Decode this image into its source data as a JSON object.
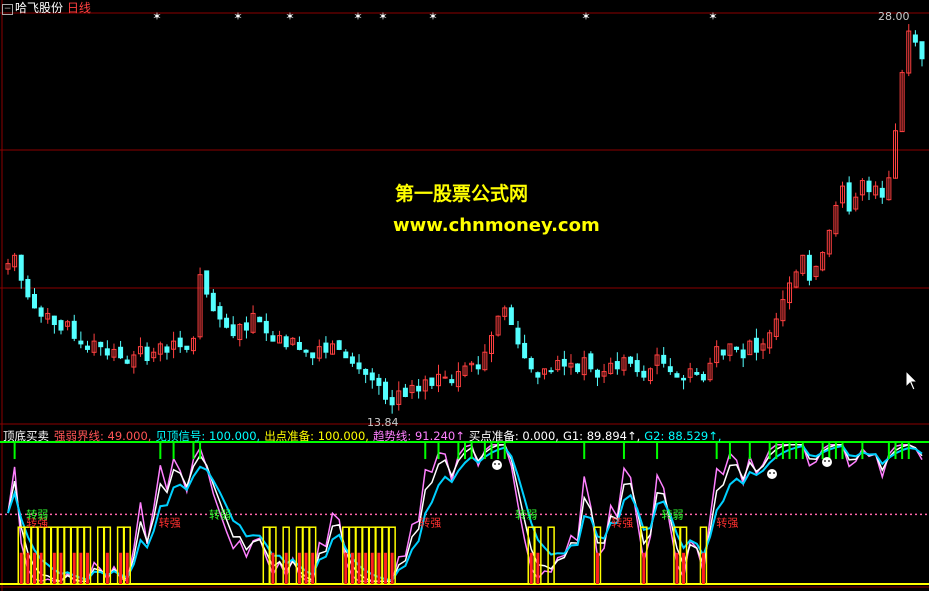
{
  "header": {
    "stock_name": "哈飞股份",
    "period": "日线",
    "price_high_label": "28.00",
    "price_low_label": "13.84"
  },
  "watermark": {
    "line1": "第一股票公式网",
    "line2": "www.chnmoney.com"
  },
  "indicator": {
    "name": "顶底买卖",
    "items": [
      {
        "label": "强弱界线: ",
        "value": "49.000,",
        "color": "#ff5555"
      },
      {
        "label": "见顶信号: ",
        "value": "100.000,",
        "color": "#00ffff"
      },
      {
        "label": "出点准备: ",
        "value": "100.000,",
        "color": "#ffff00"
      },
      {
        "label": "趋势线: ",
        "value": "91.240↑",
        "color": "#ff80ff"
      },
      {
        "label": "买点准备: ",
        "value": "0.000,",
        "color": "#ffffff"
      },
      {
        "label": "G1: ",
        "value": "89.894↑,",
        "color": "#ffffff"
      },
      {
        "label": "G2: ",
        "value": "88.529↑,",
        "color": "#00ffff"
      }
    ],
    "threshold": 49
  },
  "signals": {
    "turn_strong": "转强",
    "turn_weak": "转弱"
  },
  "colors": {
    "up": "#ff4040",
    "down": "#54ffff",
    "grid": "#8b0000",
    "threshold": "#ff66aa",
    "g1": "#ffffff",
    "g2": "#00d0ff",
    "trend": "#ff80ff",
    "yellow": "#ffff00",
    "green": "#00ff00"
  },
  "chart_data": {
    "type": "candlestick",
    "price_range": [
      13.84,
      28.0
    ],
    "closes": [
      19.2,
      19.5,
      18.6,
      18.0,
      17.6,
      17.3,
      17.4,
      17.0,
      16.8,
      17.1,
      16.5,
      16.3,
      16.1,
      16.4,
      16.2,
      15.9,
      16.1,
      15.8,
      15.6,
      15.9,
      16.2,
      15.7,
      16.0,
      16.3,
      16.0,
      16.4,
      16.2,
      16.1,
      16.5,
      18.8,
      18.1,
      17.5,
      17.2,
      16.9,
      16.6,
      17.0,
      16.8,
      17.4,
      17.1,
      16.7,
      16.4,
      16.6,
      16.2,
      16.5,
      16.1,
      16.0,
      15.8,
      16.2,
      16.0,
      16.3,
      16.1,
      15.8,
      15.6,
      15.4,
      15.2,
      15.0,
      14.8,
      14.3,
      14.1,
      14.6,
      14.4,
      14.8,
      14.6,
      15.0,
      14.8,
      15.2,
      15.1,
      14.9,
      15.3,
      15.5,
      15.6,
      15.4,
      16.0,
      16.6,
      17.3,
      17.6,
      17.0,
      16.3,
      15.8,
      15.4,
      15.1,
      15.4,
      15.3,
      15.7,
      15.5,
      15.6,
      15.3,
      15.8,
      15.4,
      15.1,
      15.3,
      15.6,
      15.4,
      15.8,
      15.6,
      15.3,
      15.1,
      15.4,
      15.9,
      15.6,
      15.3,
      15.1,
      15.0,
      15.4,
      15.2,
      15.0,
      15.6,
      16.2,
      15.9,
      16.3,
      16.1,
      15.8,
      16.4,
      16.0,
      16.3,
      16.7,
      17.2,
      17.9,
      18.5,
      18.9,
      19.5,
      18.6,
      19.1,
      19.6,
      20.4,
      21.3,
      22.0,
      21.1,
      21.6,
      22.2,
      21.8,
      22.0,
      21.6,
      22.3,
      24.0,
      26.1,
      27.6,
      27.2,
      26.6
    ],
    "turn_strong_positions": [
      0.02,
      0.165,
      0.45,
      0.66,
      0.775
    ],
    "turn_weak_positions": [
      0.02,
      0.22,
      0.555,
      0.715
    ]
  }
}
